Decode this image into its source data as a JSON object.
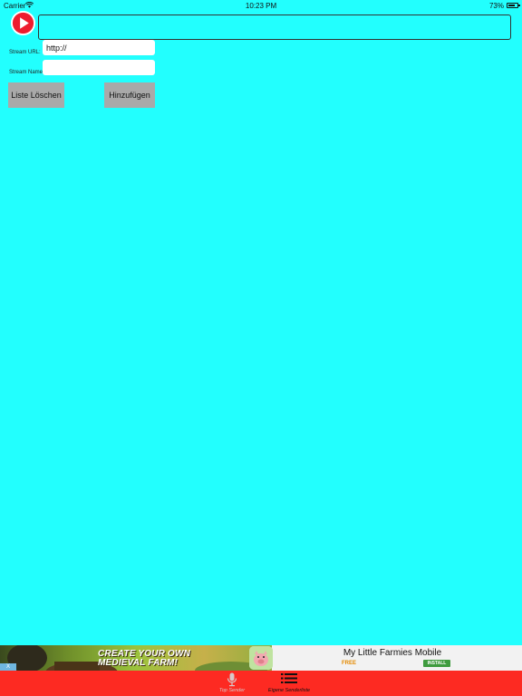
{
  "status_bar": {
    "carrier": "Carrier",
    "time": "10:23 PM",
    "battery": "73%"
  },
  "stream_form": {
    "url_label": "Stream URL:",
    "url_value": "http://",
    "name_label": "Stream Name:",
    "name_value": ""
  },
  "actions": {
    "clear_label": "Liste Löschen",
    "add_label": "Hinzufügen"
  },
  "ad": {
    "headline": "CREATE YOUR OWN MEDIEVAL FARM!",
    "close_label": "X",
    "app_title": "My Little Farmies Mobile",
    "price": "FREE",
    "install_label": "INSTALL"
  },
  "tab_bar": {
    "tabs": [
      {
        "label": "Top Sender",
        "icon": "microphone-icon",
        "active": false
      },
      {
        "label": "Eigene Senderliste",
        "icon": "list-icon",
        "active": true
      }
    ]
  },
  "colors": {
    "background": "#22fffe",
    "tab_bar": "#fd2a22",
    "button": "#a9a9a9",
    "play_red": "#ee1c2e"
  }
}
